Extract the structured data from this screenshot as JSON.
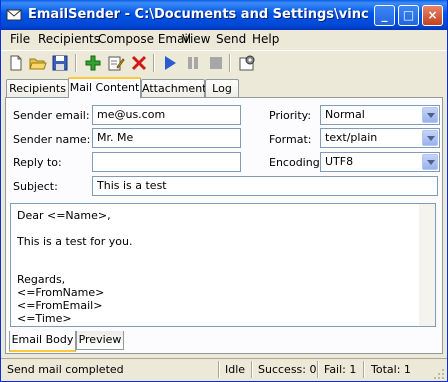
{
  "window": {
    "title": "EmailSender - C:\\Documents and Settings\\vince\\My D...",
    "buttons": {
      "minimize": "_",
      "maximize": "□",
      "close": "×"
    }
  },
  "menu": [
    "File",
    "Recipients",
    "Compose Email",
    "View",
    "Send",
    "Help"
  ],
  "toolbar": {
    "icons": [
      "new-icon",
      "open-icon",
      "save-icon",
      "add-icon",
      "edit-icon",
      "delete-icon",
      "play-icon",
      "pause-icon",
      "stop-icon",
      "settings-icon"
    ]
  },
  "tabs": [
    "Recipients",
    "Mail Content",
    "Attachment",
    "Log"
  ],
  "active_tab": "Mail Content",
  "form": {
    "sender_email_label": "Sender email:",
    "sender_email_value": "me@us.com",
    "sender_name_label": "Sender name:",
    "sender_name_value": "Mr. Me",
    "reply_to_label": "Reply to:",
    "reply_to_value": "",
    "subject_label": "Subject:",
    "subject_value": "This is a test",
    "priority_label": "Priority:",
    "priority_value": "Normal",
    "format_label": "Format:",
    "format_value": "text/plain",
    "encoding_label": "Encoding:",
    "encoding_value": "UTF8"
  },
  "body_lines": [
    "Dear <=Name>,",
    "",
    "This is a test for you.",
    "",
    "",
    "Regards,",
    "<=FromName>",
    "<=FromEmail>",
    "<=Time>"
  ],
  "bottom_tabs": [
    "Email Body",
    "Preview"
  ],
  "status": {
    "message": "Send mail completed",
    "state": "Idle",
    "success": "Success: 0",
    "fail": "Fail: 1",
    "total": "Total: 1"
  },
  "colors": {
    "accent": "#0055E5",
    "tab_highlight": "#FFC83C",
    "field_border": "#7F9DB9"
  }
}
